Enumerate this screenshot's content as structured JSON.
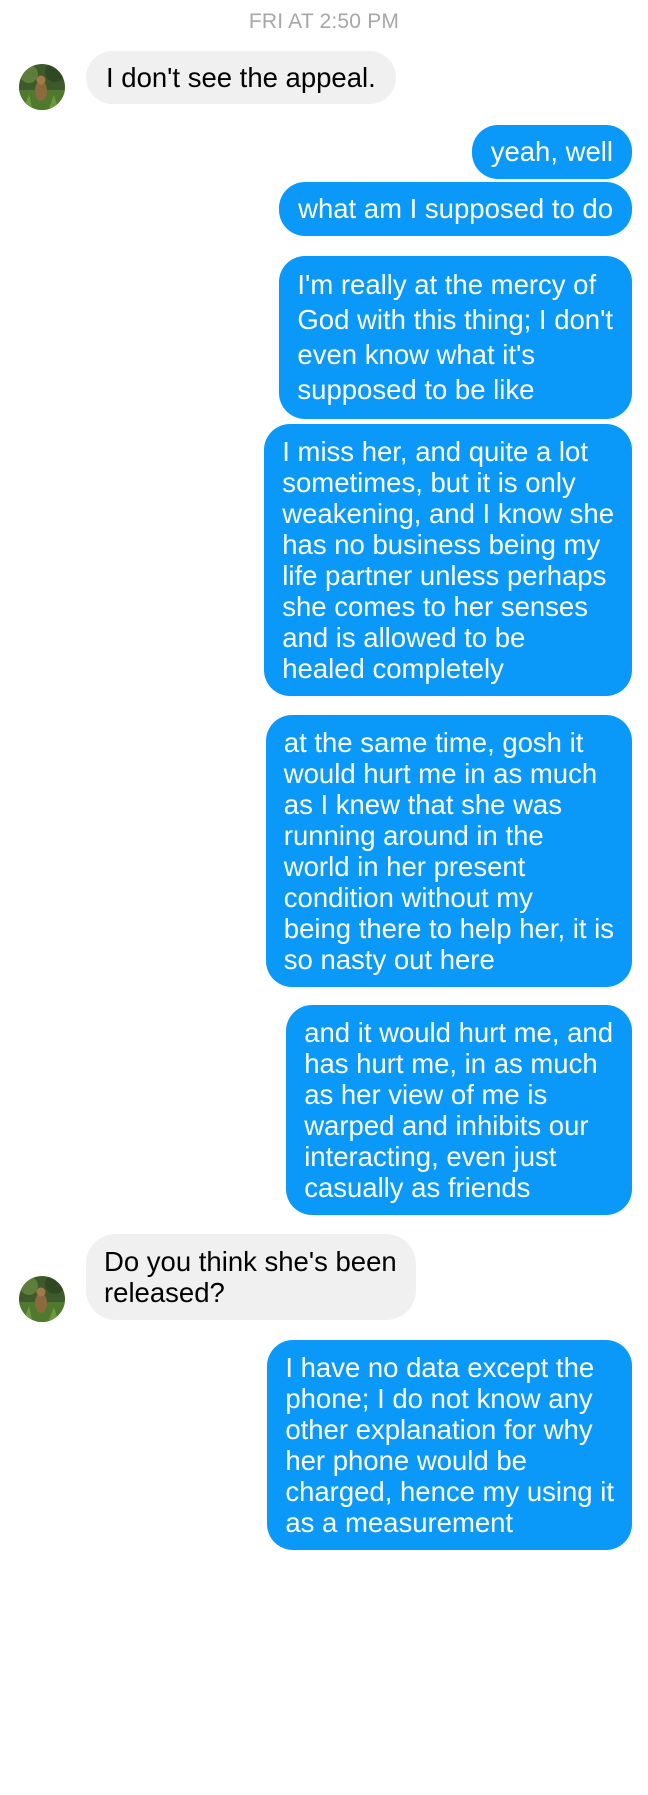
{
  "conversation": {
    "timestamp": "FRI AT 2:50 PM",
    "messages": [
      {
        "sender": "contact",
        "text": "I don't see the appeal."
      },
      {
        "sender": "me",
        "text": "yeah, well"
      },
      {
        "sender": "me",
        "text": "what am I supposed to do"
      },
      {
        "sender": "me",
        "text": "I'm really at the mercy of\nGod with this thing; I don't\neven know what it's\nsupposed to be like"
      },
      {
        "sender": "me",
        "text": "I miss her, and quite a lot\nsometimes, but it is only\nweakening, and I know she\nhas no business being my\nlife partner unless perhaps\nshe comes to her senses\nand is allowed to be\nhealed completely"
      },
      {
        "sender": "me",
        "text": "at the same time, gosh it\nwould hurt me in as much\nas I knew that she was\nrunning around in the\nworld in her present\ncondition without my\nbeing there to help her, it is\nso nasty out here"
      },
      {
        "sender": "me",
        "text": "and it would hurt me, and\nhas hurt me, in as much\nas her view of me is\nwarped and inhibits our\ninteracting, even just\ncasually as friends"
      },
      {
        "sender": "contact",
        "text": "Do you think she's been\nreleased?"
      },
      {
        "sender": "me",
        "text": "I have no data except the\nphone; I do not know any\nother explanation for why\nher phone would be\ncharged, hence my using it\nas a measurement"
      }
    ]
  },
  "colors": {
    "outgoing_bubble": "#0a99f8",
    "incoming_bubble": "#f0f0f0",
    "timestamp_text": "#a7a7a7"
  },
  "icons": {
    "avatar": "contact-avatar-photo"
  }
}
